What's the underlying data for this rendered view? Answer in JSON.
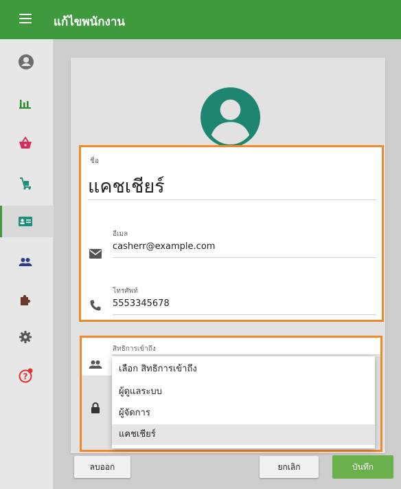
{
  "app": {
    "title": "แก้ไขพนักงาน"
  },
  "sidebar": {
    "items": [
      {
        "icon": "account-circle-icon"
      },
      {
        "icon": "bar-chart-icon"
      },
      {
        "icon": "shopping-basket-icon"
      },
      {
        "icon": "cart-dolly-icon"
      },
      {
        "icon": "id-card-icon"
      },
      {
        "icon": "people-icon"
      },
      {
        "icon": "puzzle-icon"
      },
      {
        "icon": "gear-icon"
      },
      {
        "icon": "help-icon"
      }
    ]
  },
  "form": {
    "name_label": "ชื่อ",
    "name_value": "แคชเชียร์",
    "email_label": "อีเมล",
    "email_value": "casherr@example.com",
    "phone_label": "โทรศัพท์",
    "phone_value": "5553345678",
    "role_label": "สิทธิการเข้าถึง"
  },
  "role_dropdown": {
    "options": [
      "เลือก สิทธิการเข้าถึง",
      "ผู้ดูแลระบบ",
      "ผู้จัดการ",
      "แคชเชียร์"
    ],
    "selected": "แคชเชียร์"
  },
  "actions": {
    "delete_label": "ลบออก",
    "cancel_label": "ยกเลิก",
    "save_label": "บันทึก"
  },
  "colors": {
    "brand": "#3f9a3e",
    "highlight": "#f2872b",
    "avatar": "#1e8670"
  }
}
